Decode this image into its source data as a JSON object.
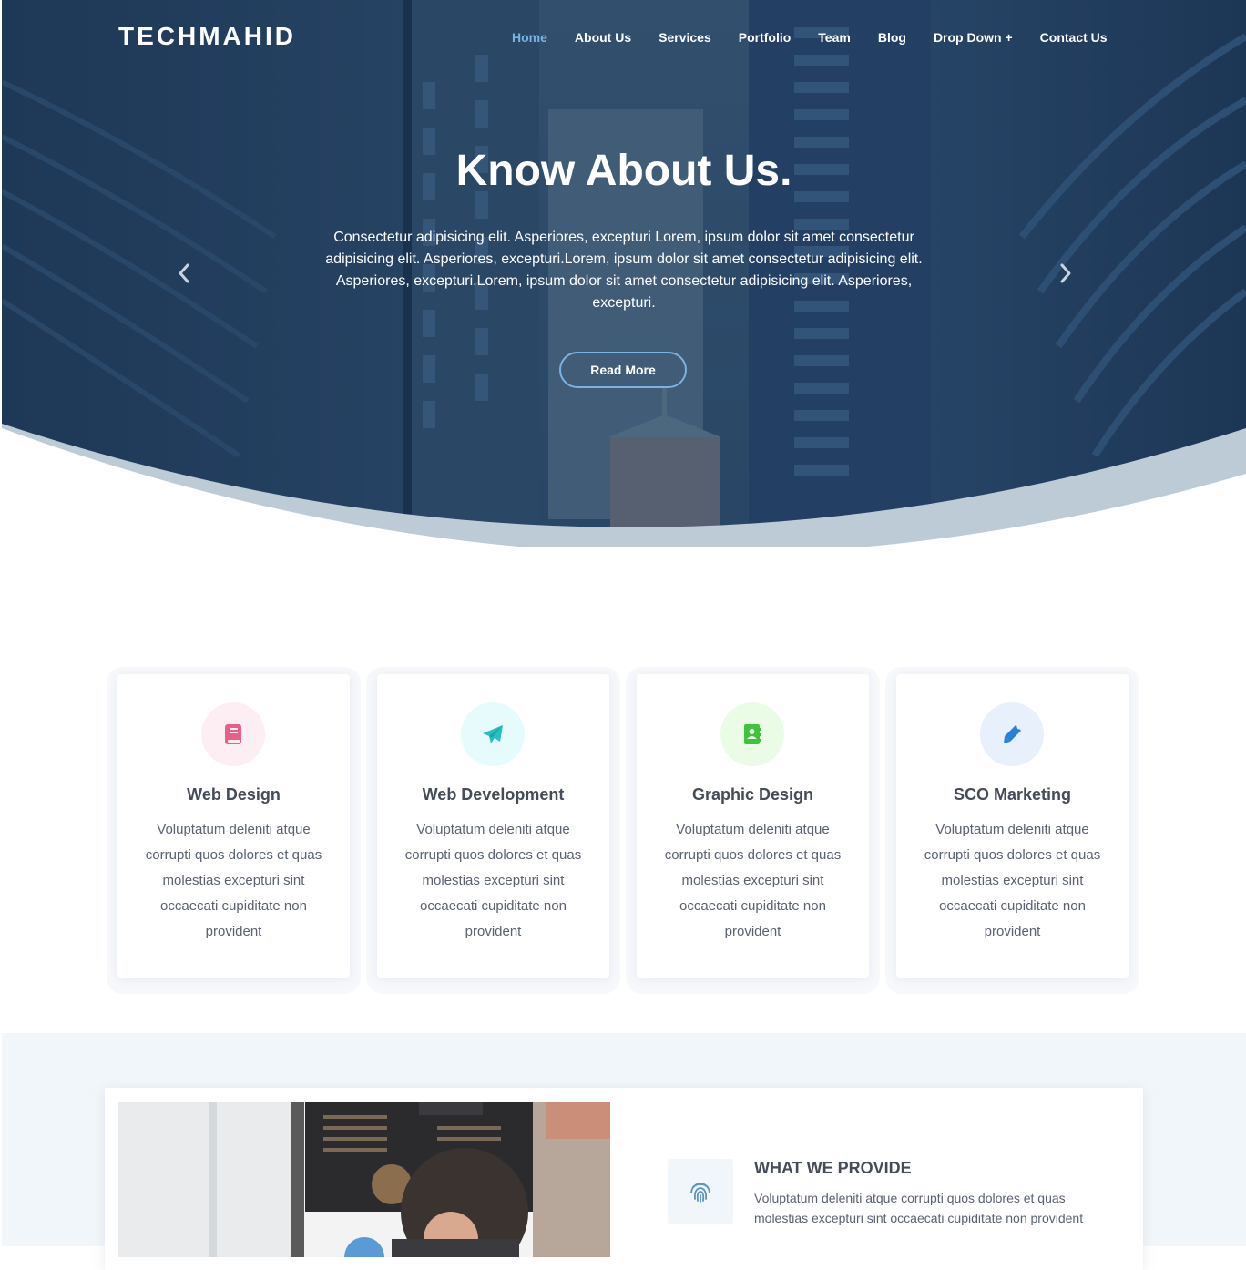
{
  "brand": {
    "logo": "TECHMAHID"
  },
  "nav": {
    "items": [
      {
        "label": "Home",
        "active": true
      },
      {
        "label": "About Us"
      },
      {
        "label": "Services"
      },
      {
        "label": "Portfolio"
      },
      {
        "label": "Team"
      },
      {
        "label": "Blog"
      },
      {
        "label": "Drop Down +"
      },
      {
        "label": "Contact Us"
      }
    ]
  },
  "hero": {
    "title": "Know About Us.",
    "text": "Consectetur adipisicing elit. Asperiores, excepturi Lorem, ipsum dolor sit amet consectetur adipisicing elit. Asperiores, excepturi.Lorem, ipsum dolor sit amet consectetur adipisicing elit. Asperiores, excepturi.Lorem, ipsum dolor sit amet consectetur adipisicing elit. Asperiores, excepturi.",
    "button": "Read More",
    "prev_icon": "chevron-left-icon",
    "next_icon": "chevron-right-icon"
  },
  "services": [
    {
      "title": "Web Design",
      "text": "Voluptatum deleniti atque corrupti quos dolores et quas molestias excepturi sint occaecati cupiditate non provident",
      "icon": "book-icon",
      "icon_color": "#e7608a",
      "icon_bg": "#fdeef3"
    },
    {
      "title": "Web Development",
      "text": "Voluptatum deleniti atque corrupti quos dolores et quas molestias excepturi sint occaecati cupiditate non provident",
      "icon": "paper-plane-icon",
      "icon_color": "#27bfc2",
      "icon_bg": "#e6fbfb"
    },
    {
      "title": "Graphic Design",
      "text": "Voluptatum deleniti atque corrupti quos dolores et quas molestias excepturi sint occaecati cupiditate non provident",
      "icon": "address-book-icon",
      "icon_color": "#3fc33f",
      "icon_bg": "#eafbe6"
    },
    {
      "title": "SCO Marketing",
      "text": "Voluptatum deleniti atque corrupti quos dolores et quas molestias excepturi sint occaecati cupiditate non provident",
      "icon": "pen-icon",
      "icon_color": "#2b7fdc",
      "icon_bg": "#e7f0fb"
    }
  ],
  "provide": {
    "title": "WHAT WE PROVIDE",
    "text": "Voluptatum deleniti atque corrupti quos dolores et quas molestias excepturi sint occaecati cupiditate non provident",
    "icon": "fingerprint-icon"
  },
  "colors": {
    "accent": "#7ab3e3",
    "hero_overlay": "#2c4a6a",
    "wave": "#bccbd6",
    "heading": "#444c57",
    "section_bg": "#f1f6fa"
  }
}
